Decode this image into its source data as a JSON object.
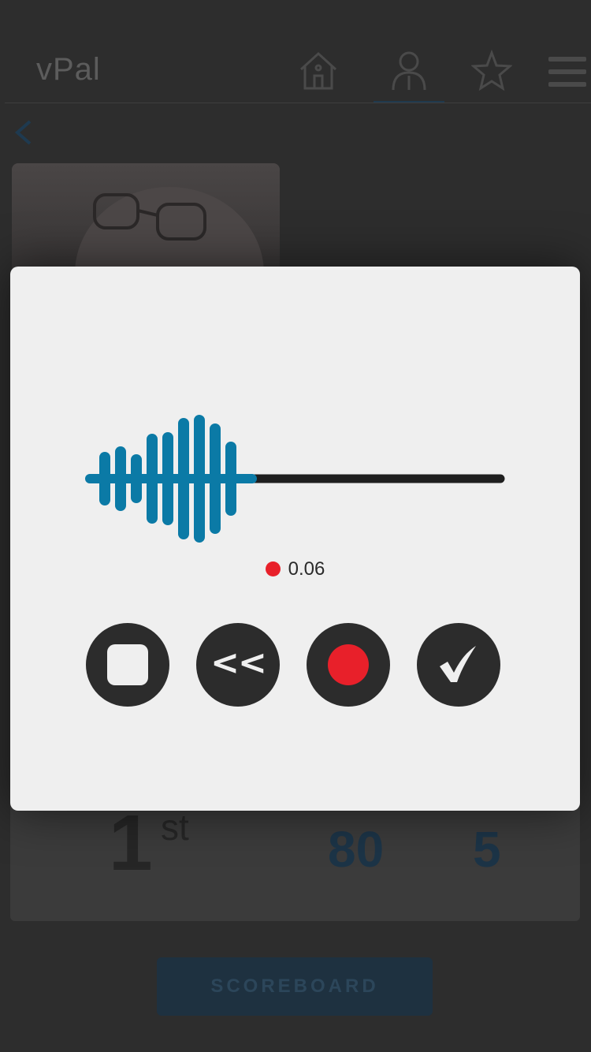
{
  "header": {
    "brand": "vPal"
  },
  "background": {
    "rank": {
      "number": "1",
      "suffix": "st"
    },
    "stats": [
      "80",
      "5"
    ],
    "scoreboard_label": "SCOREBOARD"
  },
  "recorder": {
    "elapsed": "0.06",
    "colors": {
      "wave": "#0b7aa6",
      "track": "#1f1f1f",
      "record": "#e8202a"
    },
    "controls": [
      "stop",
      "rewind",
      "record",
      "confirm"
    ],
    "rewind_label": "<<"
  }
}
